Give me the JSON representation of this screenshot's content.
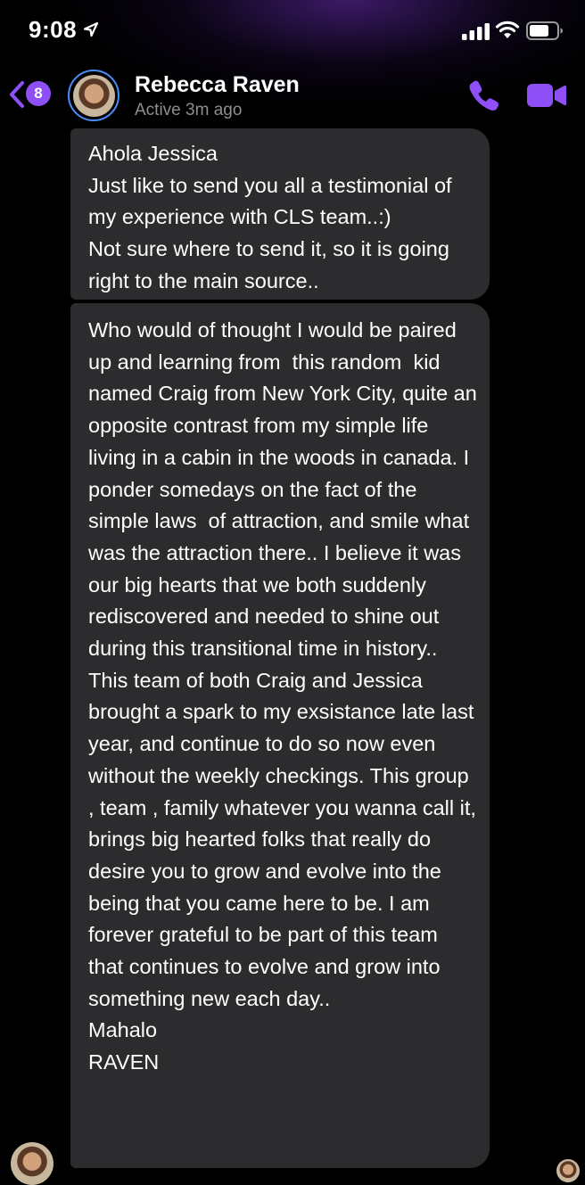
{
  "status_bar": {
    "time": "9:08",
    "icons": [
      "location-arrow-icon",
      "cellular-signal-icon",
      "wifi-icon",
      "battery-icon"
    ]
  },
  "header": {
    "back_icon": "chevron-left-icon",
    "unread_count": "8",
    "contact_name": "Rebecca Raven",
    "contact_status": "Active 3m ago",
    "call_icon": "phone-icon",
    "video_icon": "video-camera-icon"
  },
  "colors": {
    "accent": "#8e4ff7",
    "bubble_bg": "#2c2c2e",
    "background": "#000000",
    "avatar_ring": "#4a8cf5",
    "muted_text": "#8e8e93"
  },
  "messages": [
    {
      "sender": "Rebecca Raven",
      "text": "Ahola Jessica\nJust like to send you all a testimonial of my experience with CLS team..:)\nNot sure where to send it, so it is going right to the main source.."
    },
    {
      "sender": "Rebecca Raven",
      "text": "Who would of thought I would be paired up and learning from  this random  kid named Craig from New York City, quite an opposite contrast from my simple life living in a cabin in the woods in canada. I ponder somedays on the fact of the simple laws  of attraction, and smile what was the attraction there.. I believe it was our big hearts that we both suddenly rediscovered and needed to shine out during this transitional time in history..\nThis team of both Craig and Jessica brought a spark to my exsistance late last year, and continue to do so now even without the weekly checkings. This group , team , family whatever you wanna call it, brings big hearted folks that really do desire you to grow and evolve into the being that you came here to be. I am forever grateful to be part of this team that continues to evolve and grow into something new each day..\nMahalo\nRAVEN"
    }
  ]
}
